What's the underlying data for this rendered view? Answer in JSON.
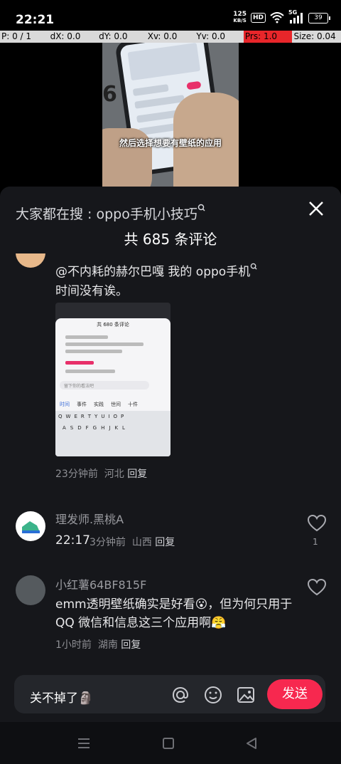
{
  "status_bar": {
    "time": "22:21",
    "net_speed_value": "125",
    "net_speed_unit": "KB/S",
    "hd_badge": "HD",
    "signal_label": "5G",
    "battery": "39"
  },
  "debug_overlay": {
    "p": "P: 0 / 1",
    "dx": "dX: 0.0",
    "dy": "dY: 0.0",
    "xv": "Xv: 0.0",
    "yv": "Yv: 0.0",
    "prs": "Prs: 1.0",
    "size": "Size: 0.04"
  },
  "video": {
    "caption": "然后选择想要有壁纸的应用",
    "number_text": "6 4"
  },
  "panel": {
    "search_prefix": "大家都在搜 : ",
    "search_term": "oppo手机小技巧",
    "comment_count": "共 685 条评论"
  },
  "comments": [
    {
      "text_line1": "@不内耗的赫尔巴嘎  我的 oppo手机",
      "text_line2": "时间没有诶。",
      "image": {
        "sheet_title": "共 680 条评论",
        "input_placeholder": "留下你的看法吧",
        "tabs": [
          "时间",
          "事件",
          "实践",
          "世间",
          "十件"
        ],
        "keys_row1": [
          "Q",
          "W",
          "E",
          "R",
          "T",
          "Y",
          "U",
          "I",
          "O",
          "P"
        ],
        "keys_row2": [
          "A",
          "S",
          "D",
          "F",
          "G",
          "H",
          "J",
          "K",
          "L"
        ]
      },
      "time": "23分钟前",
      "location": "河北",
      "reply": "回复"
    },
    {
      "username": "理发师.黑桃A",
      "text": "22:17",
      "time": "3分钟前",
      "location": "山西",
      "reply": "回复",
      "likes": "1"
    },
    {
      "username": "小红薯64BF815F",
      "text": "emm透明壁纸确实是好看😮，但为何只用于QQ 微信和信息这三个应用啊😤",
      "time": "1小时前",
      "location": "湖南",
      "reply": "回复"
    }
  ],
  "input_bar": {
    "text": "关不掉了🗿",
    "send_label": "发送"
  },
  "colors": {
    "accent": "#f7284f",
    "panel_bg": "#16171b",
    "debug_highlight": "#e8262a"
  }
}
